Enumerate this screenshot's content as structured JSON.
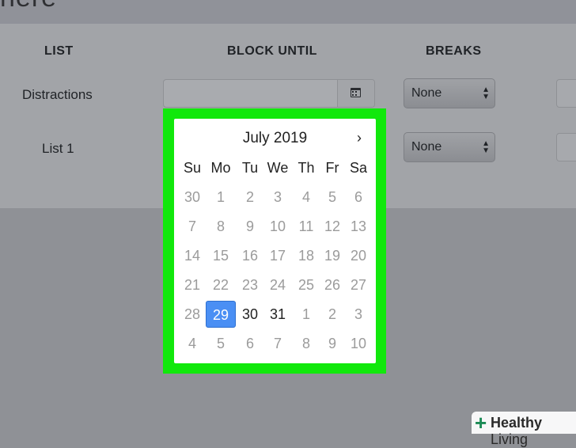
{
  "page": {
    "title_fragment": "nere"
  },
  "table": {
    "headers": [
      "LIST",
      "BLOCK UNTIL",
      "BREAKS"
    ],
    "rows": [
      {
        "label": "Distractions",
        "breaks": "None"
      },
      {
        "label": "List 1",
        "breaks": "None"
      }
    ]
  },
  "datepicker": {
    "month_label": "July 2019",
    "next_label": "›",
    "weekdays": [
      "Su",
      "Mo",
      "Tu",
      "We",
      "Th",
      "Fr",
      "Sa"
    ],
    "weeks": [
      [
        "30",
        "1",
        "2",
        "3",
        "4",
        "5",
        "6"
      ],
      [
        "7",
        "8",
        "9",
        "10",
        "11",
        "12",
        "13"
      ],
      [
        "14",
        "15",
        "16",
        "17",
        "18",
        "19",
        "20"
      ],
      [
        "21",
        "22",
        "23",
        "24",
        "25",
        "26",
        "27"
      ],
      [
        "28",
        "29",
        "30",
        "31",
        "1",
        "2",
        "3"
      ],
      [
        "4",
        "5",
        "6",
        "7",
        "8",
        "9",
        "10"
      ]
    ],
    "selected": "29",
    "highlight_color": "#11e80c",
    "selected_color": "#4a8ff4"
  },
  "watermark": {
    "bold": "Healthy",
    "rest": " Living"
  }
}
